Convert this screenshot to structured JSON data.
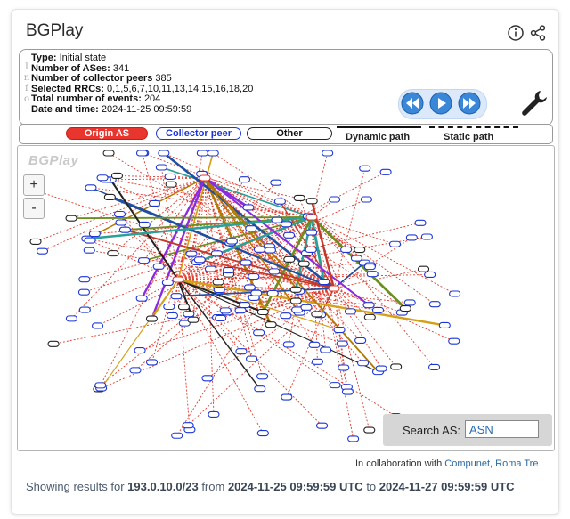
{
  "app": {
    "title": "BGPlay"
  },
  "header": {
    "info_icon": "info-icon",
    "share_icon": "share-icon"
  },
  "info": {
    "vertical_label": [
      "I",
      "n",
      "f",
      "o"
    ],
    "lines": [
      {
        "key": "Type:",
        "value": "Initial state"
      },
      {
        "key": "Number of ASes:",
        "value": "341"
      },
      {
        "key": "Number of collector peers",
        "value": "385"
      },
      {
        "key": "Selected RRCs:",
        "value": "0,1,5,6,7,10,11,13,14,15,16,18,20"
      },
      {
        "key": "Total number of events:",
        "value": "204"
      },
      {
        "key": "Date and time:",
        "value": "2024-11-25 09:59:59"
      }
    ]
  },
  "controls": {
    "prev_icon": "rewind-icon",
    "play_icon": "play-icon",
    "next_icon": "fast-forward-icon",
    "settings_icon": "wrench-icon"
  },
  "legend": {
    "origin": "Origin AS",
    "collector": "Collector peer",
    "other": "Other",
    "dynamic": "Dynamic path",
    "static": "Static path"
  },
  "graph": {
    "watermark": "BGPlay",
    "zoom_in": "+",
    "zoom_out": "-",
    "colors": {
      "origin": "#e8352d",
      "collector": "#1b36d8",
      "other": "#222222",
      "edge_default": "#e23a2e"
    }
  },
  "search": {
    "label": "Search AS:",
    "placeholder": "ASN"
  },
  "footer": {
    "collab_prefix": "In collaboration with ",
    "collab_link1": "Compunet",
    "collab_sep": ", ",
    "collab_link2": "Roma Tre",
    "results_prefix": "Showing results for ",
    "prefix": "193.0.10.0/23",
    "from_word": " from ",
    "from": "2024-11-25 09:59:59 UTC",
    "to_word": " to ",
    "to": "2024-11-27 09:59:59 UTC"
  }
}
